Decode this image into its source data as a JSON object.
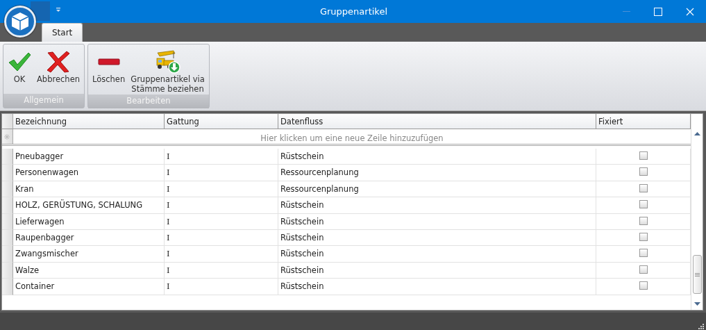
{
  "window": {
    "title": "Gruppenartikel"
  },
  "tabs": [
    {
      "label": "Start",
      "selected": true
    }
  ],
  "ribbon_groups": [
    {
      "label": "Allgemein",
      "buttons": [
        {
          "label": "OK",
          "kind": "check"
        },
        {
          "label": "Abbrechen",
          "kind": "cross"
        }
      ]
    },
    {
      "label": "Bearbeiten",
      "buttons": [
        {
          "label": "Löschen",
          "kind": "minus"
        },
        {
          "label": "Gruppenartikel via\nStämme beziehen",
          "kind": "crane"
        }
      ]
    }
  ],
  "table": {
    "columns": [
      "Bezeichnung",
      "Gattung",
      "Datenfluss",
      "Fixiert"
    ],
    "new_row_hint": "Hier klicken um eine neue Zeile hinzuzufügen",
    "rows": [
      {
        "bezeichnung": "Pneubagger",
        "gattung": "I",
        "datenfluss": "Rüstschein",
        "fixiert": false
      },
      {
        "bezeichnung": "Personenwagen",
        "gattung": "I",
        "datenfluss": "Ressourcenplanung",
        "fixiert": false
      },
      {
        "bezeichnung": "Kran",
        "gattung": "I",
        "datenfluss": "Ressourcenplanung",
        "fixiert": false
      },
      {
        "bezeichnung": "HOLZ, GERÜSTUNG, SCHALUNG",
        "gattung": "I",
        "datenfluss": "Rüstschein",
        "fixiert": false
      },
      {
        "bezeichnung": "Lieferwagen",
        "gattung": "I",
        "datenfluss": "Rüstschein",
        "fixiert": false
      },
      {
        "bezeichnung": "Raupenbagger",
        "gattung": "I",
        "datenfluss": "Rüstschein",
        "fixiert": false
      },
      {
        "bezeichnung": "Zwangsmischer",
        "gattung": "I",
        "datenfluss": "Rüstschein",
        "fixiert": false
      },
      {
        "bezeichnung": "Walze",
        "gattung": "I",
        "datenfluss": "Rüstschein",
        "fixiert": false
      },
      {
        "bezeichnung": "Container",
        "gattung": "I",
        "datenfluss": "Rüstschein",
        "fixiert": false
      }
    ]
  }
}
